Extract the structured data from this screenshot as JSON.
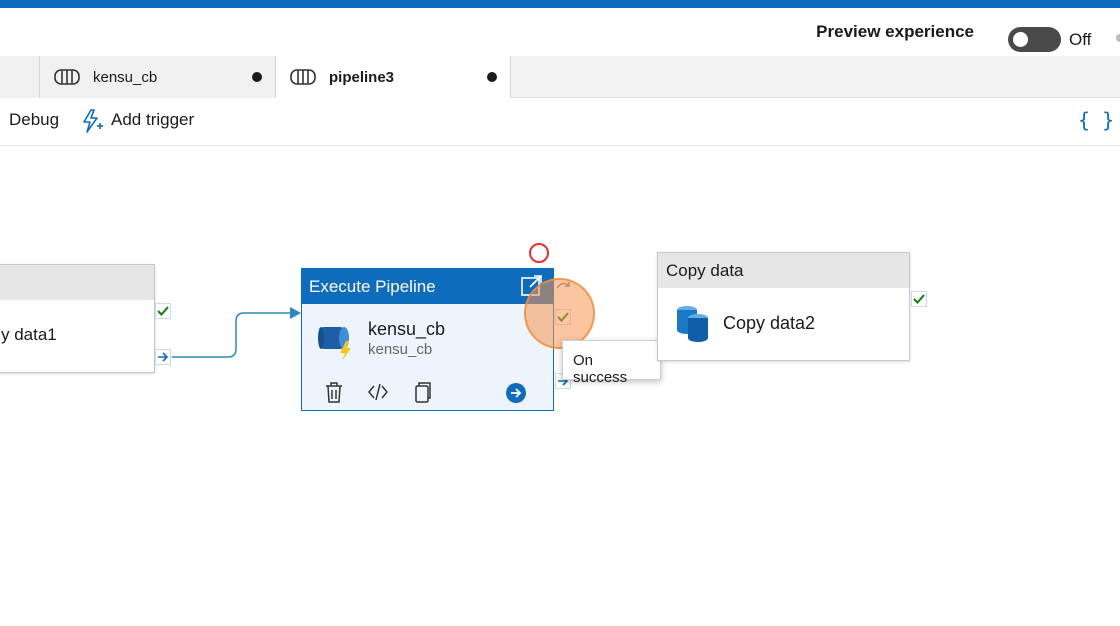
{
  "header": {
    "preview_label": "Preview experience",
    "toggle_state": "Off"
  },
  "tabs": [
    {
      "label": "kensu_cb",
      "unsaved": true,
      "active": false,
      "icon": "pipeline-icon"
    },
    {
      "label": "pipeline3",
      "unsaved": true,
      "active": true,
      "icon": "pipeline-icon"
    }
  ],
  "toolbar": {
    "debug_label": "Debug",
    "add_trigger_label": "Add trigger",
    "code_icon": "braces-icon"
  },
  "canvas": {
    "left_activity": {
      "name": "y data1"
    },
    "execute_pipeline": {
      "header": "Execute Pipeline",
      "title": "kensu_cb",
      "subtitle": "kensu_cb",
      "controls": [
        "delete-icon",
        "code-icon",
        "copy-icon",
        "navigate-icon"
      ]
    },
    "copy_activity": {
      "header": "Copy data",
      "name": "Copy data2"
    },
    "tooltip": "On success"
  },
  "colors": {
    "accent": "#0f6cbd",
    "success": "#107c10",
    "failure": "#d13438"
  }
}
